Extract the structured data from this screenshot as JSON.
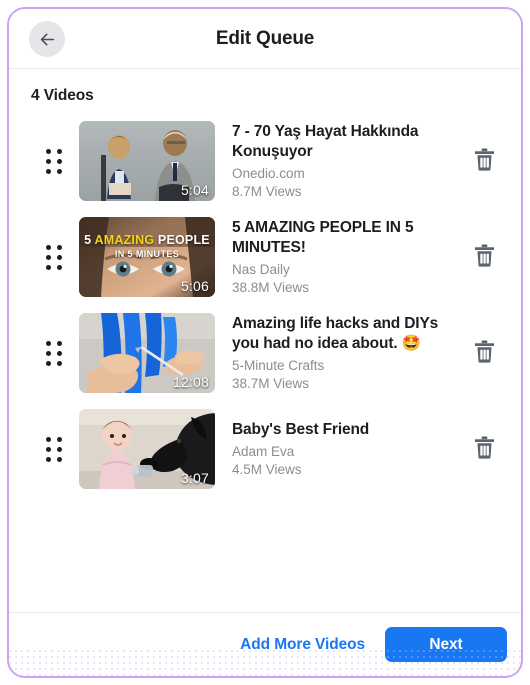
{
  "window": {
    "frame_border_color": "#caa4ef",
    "background": "#ffffff"
  },
  "header": {
    "title": "Edit Queue",
    "back_icon": "arrow-left-icon",
    "back_button_bg": "#e7e5ea"
  },
  "main": {
    "count_label": "4 Videos",
    "videos": [
      {
        "title": "7 - 70 Yaş Hayat Hakkında Konuşuyor",
        "author": "Onedio.com",
        "views": "8.7M Views",
        "duration": "5:04",
        "drag_icon": "drag-handle-icon",
        "delete_icon": "trash-icon",
        "thumbnail_alt": "young girl and elderly man seated facing each other",
        "overlay_line1": "",
        "overlay_line1_highlight": "",
        "overlay_line1_tail": "",
        "overlay_line2": ""
      },
      {
        "title": "5 AMAZING PEOPLE IN 5 MINUTES!",
        "author": "Nas Daily",
        "views": "38.8M Views",
        "duration": "5:06",
        "drag_icon": "drag-handle-icon",
        "delete_icon": "trash-icon",
        "thumbnail_alt": "close-up of a person's eyes with title text overlay",
        "overlay_line1": "5 ",
        "overlay_line1_highlight": "AMAZING",
        "overlay_line1_tail": " PEOPLE",
        "overlay_line2": "IN 5 MINUTES"
      },
      {
        "title": "Amazing life hacks and DIYs you had no idea about. 🤩",
        "author": "5-Minute Crafts",
        "views": "38.7M Views",
        "duration": "12:08",
        "drag_icon": "drag-handle-icon",
        "delete_icon": "trash-icon",
        "thumbnail_alt": "hands cutting a blue pool noodle with a knife",
        "overlay_line1": "",
        "overlay_line1_highlight": "",
        "overlay_line1_tail": "",
        "overlay_line2": ""
      },
      {
        "title": "Baby's Best Friend",
        "author": "Adam Eva",
        "views": "4.5M Views",
        "duration": "3:07",
        "drag_icon": "drag-handle-icon",
        "delete_icon": "trash-icon",
        "thumbnail_alt": "baby sitting facing a black labrador dog",
        "overlay_line1": "",
        "overlay_line1_highlight": "",
        "overlay_line1_tail": "",
        "overlay_line2": ""
      }
    ]
  },
  "footer": {
    "add_more_label": "Add More Videos",
    "next_label": "Next",
    "link_color": "#1877f2",
    "primary_button_color": "#1877f2"
  }
}
